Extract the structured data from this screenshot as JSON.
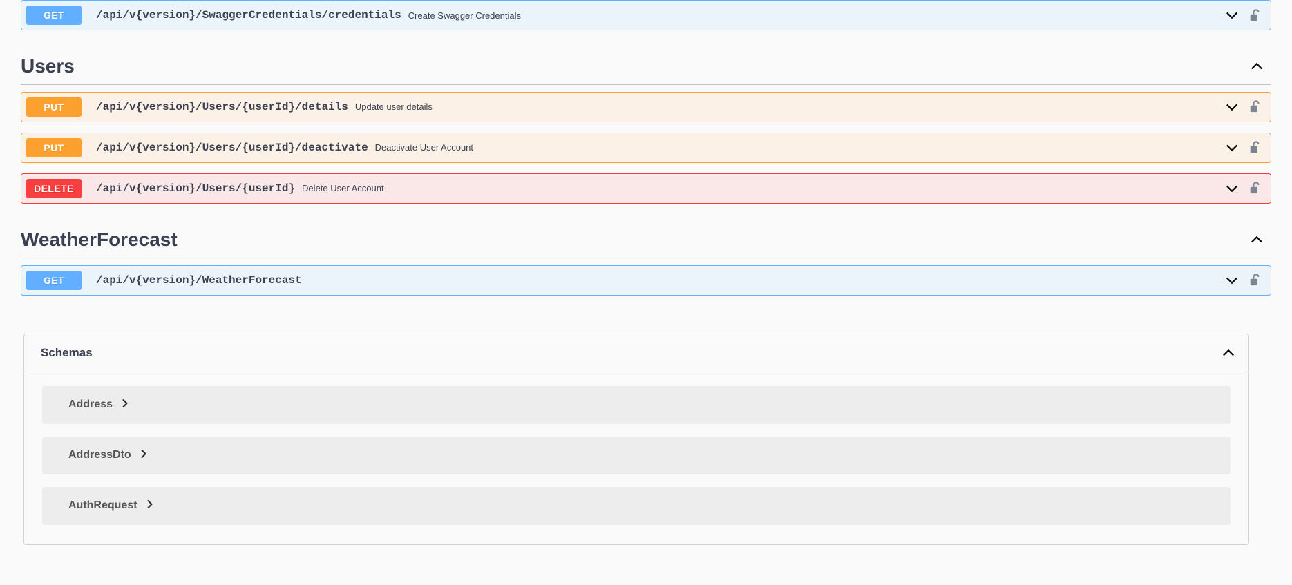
{
  "page": {
    "background": "#fafafa",
    "text_color": "#3b4151"
  },
  "colors": {
    "get": "#61affe",
    "put": "#fca130",
    "delete": "#f93e3e",
    "get_bg": "#ebf3fb",
    "put_bg": "#fbf1e6",
    "delete_bg": "#fae7e7",
    "schema_row_bg": "#ededed",
    "lock": "#7d8492"
  },
  "top_operation": {
    "method": "GET",
    "path": "/api/v{version}/SwaggerCredentials/credentials",
    "summary": "Create Swagger Credentials",
    "expand_icon": "chevron-down-icon",
    "auth_icon": "unlocked-padlock-icon"
  },
  "sections": [
    {
      "title": "Users",
      "collapse_icon": "chevron-up-icon",
      "operations": [
        {
          "method": "PUT",
          "path": "/api/v{version}/Users/{userId}/details",
          "summary": "Update user details",
          "expand_icon": "chevron-down-icon",
          "auth_icon": "unlocked-padlock-icon"
        },
        {
          "method": "PUT",
          "path": "/api/v{version}/Users/{userId}/deactivate",
          "summary": "Deactivate User Account",
          "expand_icon": "chevron-down-icon",
          "auth_icon": "unlocked-padlock-icon"
        },
        {
          "method": "DELETE",
          "path": "/api/v{version}/Users/{userId}",
          "summary": "Delete User Account",
          "expand_icon": "chevron-down-icon",
          "auth_icon": "unlocked-padlock-icon"
        }
      ]
    },
    {
      "title": "WeatherForecast",
      "collapse_icon": "chevron-up-icon",
      "operations": [
        {
          "method": "GET",
          "path": "/api/v{version}/WeatherForecast",
          "summary": "",
          "expand_icon": "chevron-down-icon",
          "auth_icon": "unlocked-padlock-icon"
        }
      ]
    }
  ],
  "schemas": {
    "title": "Schemas",
    "collapse_icon": "chevron-up-icon",
    "items": [
      {
        "name": "Address",
        "expand_icon": "chevron-right-icon"
      },
      {
        "name": "AddressDto",
        "expand_icon": "chevron-right-icon"
      },
      {
        "name": "AuthRequest",
        "expand_icon": "chevron-right-icon"
      }
    ]
  }
}
